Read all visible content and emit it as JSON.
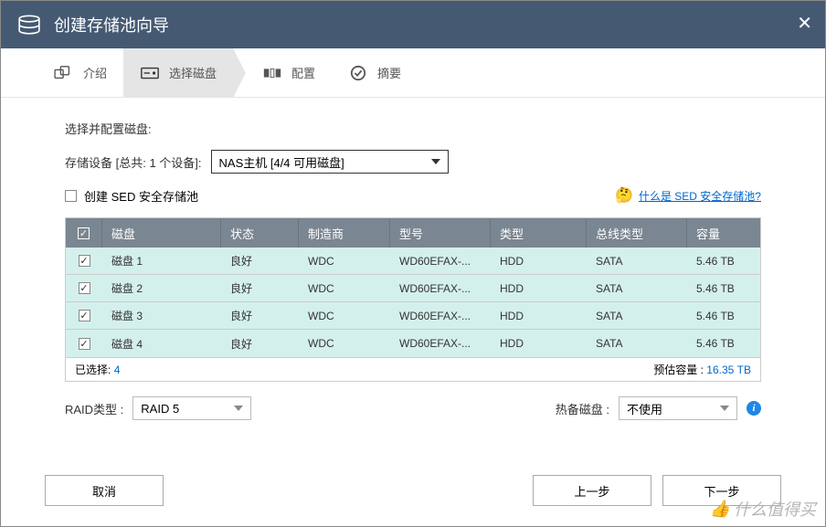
{
  "title": "创建存储池向导",
  "steps": {
    "intro": "介绍",
    "select_disk": "选择磁盘",
    "config": "配置",
    "summary": "摘要"
  },
  "content": {
    "section_label": "选择并配置磁盘:",
    "storage_device_label": "存储设备 [总共: 1 个设备]:",
    "storage_device_value": "NAS主机 [4/4 可用磁盘]",
    "sed_checkbox_label": "创建 SED 安全存储池",
    "sed_link": "什么是 SED 安全存储池?"
  },
  "table": {
    "headers": {
      "disk": "磁盘",
      "status": "状态",
      "manufacturer": "制造商",
      "model": "型号",
      "type": "类型",
      "bus_type": "总线类型",
      "capacity": "容量"
    },
    "rows": [
      {
        "disk": "磁盘 1",
        "status": "良好",
        "mfr": "WDC",
        "model": "WD60EFAX-...",
        "type": "HDD",
        "bus": "SATA",
        "cap": "5.46 TB"
      },
      {
        "disk": "磁盘 2",
        "status": "良好",
        "mfr": "WDC",
        "model": "WD60EFAX-...",
        "type": "HDD",
        "bus": "SATA",
        "cap": "5.46 TB"
      },
      {
        "disk": "磁盘 3",
        "status": "良好",
        "mfr": "WDC",
        "model": "WD60EFAX-...",
        "type": "HDD",
        "bus": "SATA",
        "cap": "5.46 TB"
      },
      {
        "disk": "磁盘 4",
        "status": "良好",
        "mfr": "WDC",
        "model": "WD60EFAX-...",
        "type": "HDD",
        "bus": "SATA",
        "cap": "5.46 TB"
      }
    ],
    "footer": {
      "selected_label": "已选择:",
      "selected_count": "4",
      "estimated_label": "预估容量 :",
      "estimated_value": "16.35 TB"
    }
  },
  "raid": {
    "raid_type_label": "RAID类型 :",
    "raid_type_value": "RAID 5",
    "hot_spare_label": "热备磁盘 :",
    "hot_spare_value": "不使用"
  },
  "buttons": {
    "cancel": "取消",
    "prev": "上一步",
    "next": "下一步"
  },
  "watermark": "什么值得买"
}
